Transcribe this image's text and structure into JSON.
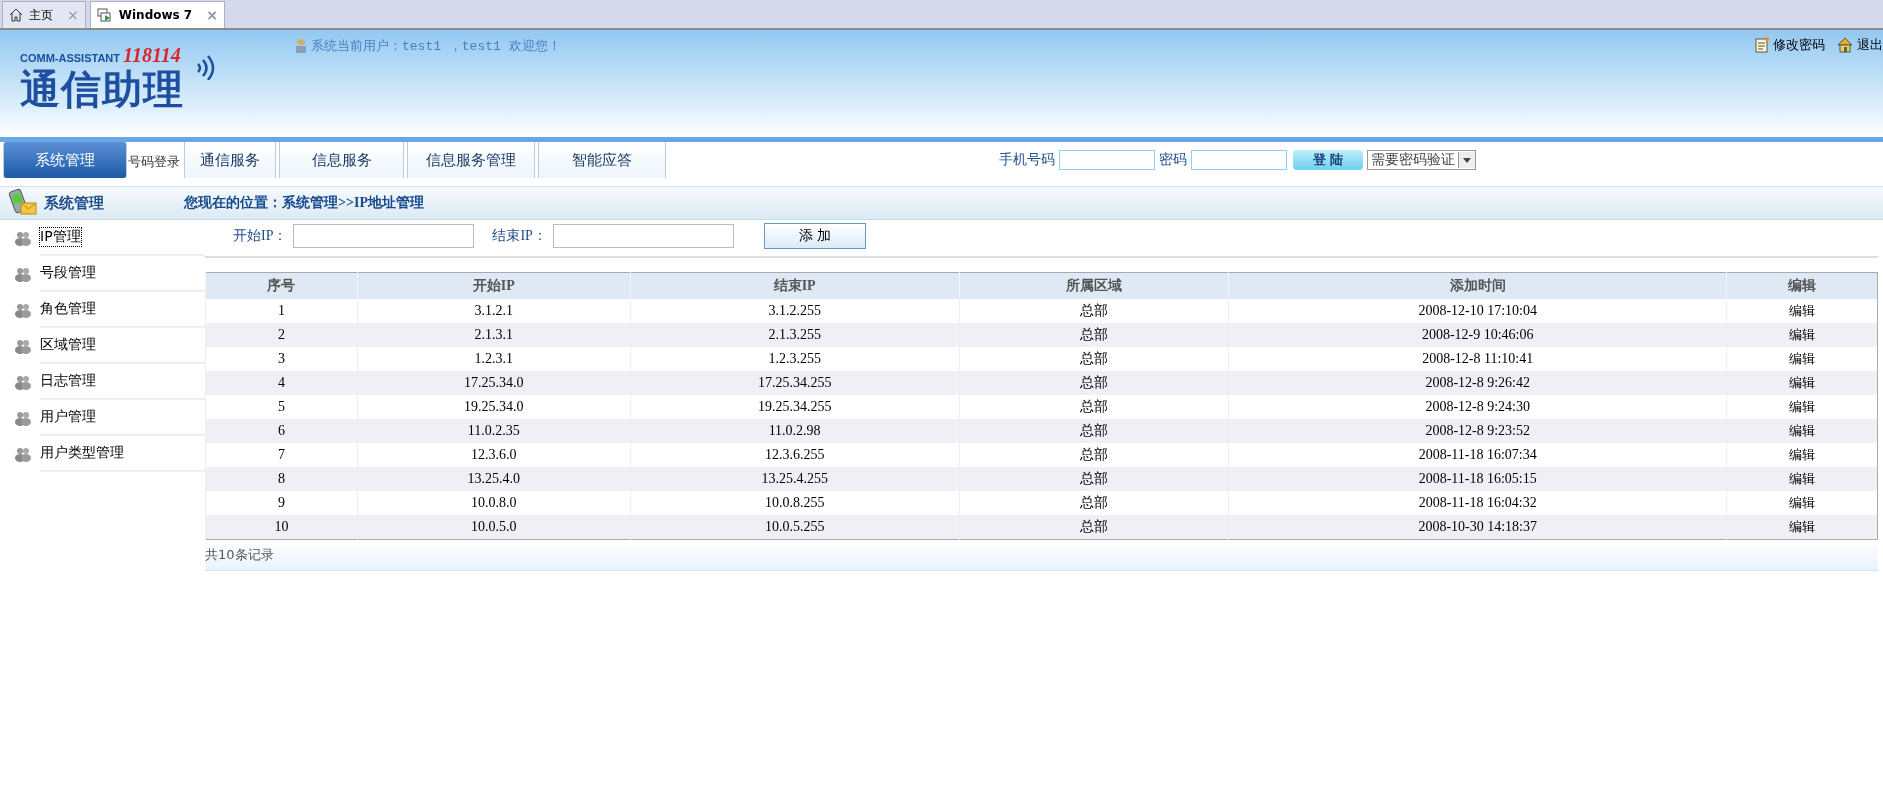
{
  "browser_tabs": [
    {
      "label": "主页",
      "close": "×",
      "selected": false
    },
    {
      "label": "Windows 7",
      "close": "×",
      "selected": true
    }
  ],
  "header": {
    "logo_tagline": "COMM-ASSISTANT",
    "logo_number": "118114",
    "logo_title": "通信助理",
    "welcome": "系统当前用户：test1 ，test1 欢迎您！",
    "links": [
      "修改密码",
      "退出"
    ]
  },
  "nav": {
    "tabs": [
      {
        "label": "系统管理",
        "selected": true
      },
      {
        "label": "通信服务",
        "selected": false
      },
      {
        "label": "信息服务",
        "selected": false
      },
      {
        "label": "信息服务管理",
        "selected": false
      },
      {
        "label": "智能应答",
        "selected": false
      }
    ],
    "hidden_label": "号码登录",
    "login": {
      "phone_label": "手机号码",
      "password_label": "密码",
      "button": "登 陆",
      "mode": "需要密码验证"
    }
  },
  "section": {
    "title": "系统管理",
    "breadcrumb": "您现在的位置：系统管理>>IP地址管理"
  },
  "sidebar": {
    "items": [
      {
        "label": "IP管理",
        "selected": true
      },
      {
        "label": "号段管理",
        "selected": false
      },
      {
        "label": "角色管理",
        "selected": false
      },
      {
        "label": "区域管理",
        "selected": false
      },
      {
        "label": "日志管理",
        "selected": false
      },
      {
        "label": "用户管理",
        "selected": false
      },
      {
        "label": "用户类型管理",
        "selected": false
      }
    ]
  },
  "add_form": {
    "start_label": "开始IP：",
    "end_label": "结束IP：",
    "button": "添 加"
  },
  "table": {
    "columns": [
      "序号",
      "开始IP",
      "结束IP",
      "所属区域",
      "添加时间",
      "编辑"
    ],
    "rows": [
      [
        "1",
        "3.1.2.1",
        "3.1.2.255",
        "总部",
        "2008-12-10 17:10:04",
        "编辑"
      ],
      [
        "2",
        "2.1.3.1",
        "2.1.3.255",
        "总部",
        "2008-12-9 10:46:06",
        "编辑"
      ],
      [
        "3",
        "1.2.3.1",
        "1.2.3.255",
        "总部",
        "2008-12-8 11:10:41",
        "编辑"
      ],
      [
        "4",
        "17.25.34.0",
        "17.25.34.255",
        "总部",
        "2008-12-8 9:26:42",
        "编辑"
      ],
      [
        "5",
        "19.25.34.0",
        "19.25.34.255",
        "总部",
        "2008-12-8 9:24:30",
        "编辑"
      ],
      [
        "6",
        "11.0.2.35",
        "11.0.2.98",
        "总部",
        "2008-12-8 9:23:52",
        "编辑"
      ],
      [
        "7",
        "12.3.6.0",
        "12.3.6.255",
        "总部",
        "2008-11-18 16:07:34",
        "编辑"
      ],
      [
        "8",
        "13.25.4.0",
        "13.25.4.255",
        "总部",
        "2008-11-18 16:05:15",
        "编辑"
      ],
      [
        "9",
        "10.0.8.0",
        "10.0.8.255",
        "总部",
        "2008-11-18 16:04:32",
        "编辑"
      ],
      [
        "10",
        "10.0.5.0",
        "10.0.5.255",
        "总部",
        "2008-10-30 14:18:37",
        "编辑"
      ]
    ],
    "footer": "共10条记录"
  }
}
